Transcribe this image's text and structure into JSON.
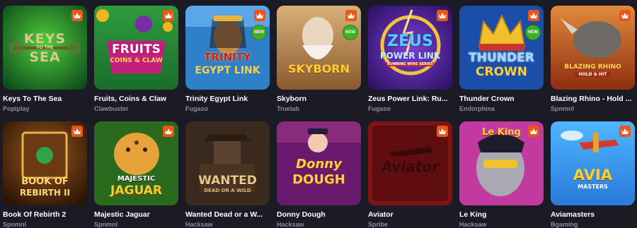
{
  "games": [
    {
      "title": "Keys To The Sea",
      "provider": "Popiplay",
      "logo": [
        "KEYS",
        "TO THE",
        "SEA"
      ],
      "new": false,
      "art": "keys-sea-art"
    },
    {
      "title": "Fruits, Coins & Claw",
      "provider": "Clawbuster",
      "logo": [
        "FRUITS",
        "COINS & CLAW"
      ],
      "new": false,
      "art": "fruits-coins-art"
    },
    {
      "title": "Trinity Egypt Link",
      "provider": "Fugaso",
      "logo": [
        "TRINITY",
        "EGYPT LINK"
      ],
      "new": true,
      "new_label": "NEW",
      "art": "trinity-egypt-art"
    },
    {
      "title": "Skyborn",
      "provider": "Truelab",
      "logo": [
        "SKYBORN"
      ],
      "new": true,
      "new_label": "NEW",
      "art": "skyborn-art"
    },
    {
      "title": "Zeus Power Link: Ru...",
      "provider": "Fugaso",
      "logo": [
        "ZEUS",
        "POWER LINK",
        "RUNNING WINS SERIES"
      ],
      "new": false,
      "art": "zeus-power-art"
    },
    {
      "title": "Thunder Crown",
      "provider": "Endorphina",
      "logo": [
        "THUNDER",
        "CROWN"
      ],
      "new": true,
      "new_label": "NEW",
      "art": "thunder-crown-art"
    },
    {
      "title": "Blazing Rhino - Hold ...",
      "provider": "Spnmnl",
      "logo": [
        "BLAZING RHINO",
        "HOLD & HIT"
      ],
      "new": false,
      "art": "blazing-rhino-art"
    },
    {
      "title": "Book Of Rebirth 2",
      "provider": "Spnmnl",
      "logo": [
        "BOOK OF",
        "REBIRTH II"
      ],
      "new": false,
      "art": "book-rebirth-art"
    },
    {
      "title": "Majestic Jaguar",
      "provider": "Spnmnl",
      "logo": [
        "MAJESTIC",
        "JAGUAR"
      ],
      "new": false,
      "art": "majestic-jaguar-art"
    },
    {
      "title": "Wanted Dead or a W...",
      "provider": "Hacksaw",
      "logo": [
        "WANTED",
        "DEAD OR A WILD"
      ],
      "new": false,
      "art": "wanted-art"
    },
    {
      "title": "Donny Dough",
      "provider": "Hacksaw",
      "logo": [
        "Donny",
        "DOUGH"
      ],
      "new": false,
      "art": "donny-dough-art"
    },
    {
      "title": "Aviator",
      "provider": "Spribe",
      "logo": [
        "Aviator"
      ],
      "new": false,
      "art": "aviator-art"
    },
    {
      "title": "Le King",
      "provider": "Hacksaw",
      "logo": [
        "Le King"
      ],
      "new": false,
      "art": "le-king-art"
    },
    {
      "title": "Aviamasters",
      "provider": "Bgaming",
      "logo": [
        "AVIA",
        "MASTERS"
      ],
      "new": false,
      "art": "aviamasters-art"
    }
  ],
  "badge_icon": "crown-icon",
  "colors": {
    "background": "#1b1b26",
    "badge": "#e8571a",
    "new_badge": "#3fae2a",
    "title": "#ffffff",
    "provider": "#8c8c9c"
  }
}
